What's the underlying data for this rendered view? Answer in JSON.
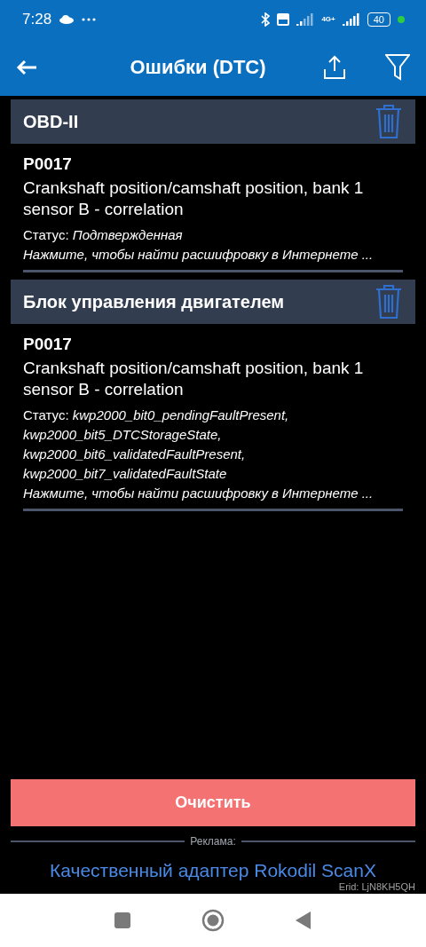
{
  "status_bar": {
    "time": "7:28",
    "network": "4G+",
    "battery": "40"
  },
  "app_bar": {
    "title": "Ошибки (DTC)"
  },
  "sections": [
    {
      "title": "OBD-II",
      "errors": [
        {
          "code": "P0017",
          "description": "Crankshaft position/camshaft position, bank 1 sensor B - correlation",
          "status": "Статус: *Подтвержденная*",
          "hint": "Нажмите, чтобы найти расшифровку в Интернете ..."
        }
      ]
    },
    {
      "title": "Блок управления двигателем",
      "errors": [
        {
          "code": "P0017",
          "description": "Crankshaft position/camshaft position, bank 1 sensor B - correlation",
          "status": "Статус: *kwp2000_bit0_pendingFaultPresent, kwp2000_bit5_DTCStorageState, kwp2000_bit6_validatedFaultPresent, kwp2000_bit7_validatedFaultState*",
          "hint": "Нажмите, чтобы найти расшифровку в Интернете ..."
        }
      ]
    }
  ],
  "clear_button": "Очистить",
  "ad": {
    "label": "Реклама:",
    "link": "Качественный адаптер Rokodil ScanX",
    "erid": "Erid: LjN8KH5QH"
  }
}
